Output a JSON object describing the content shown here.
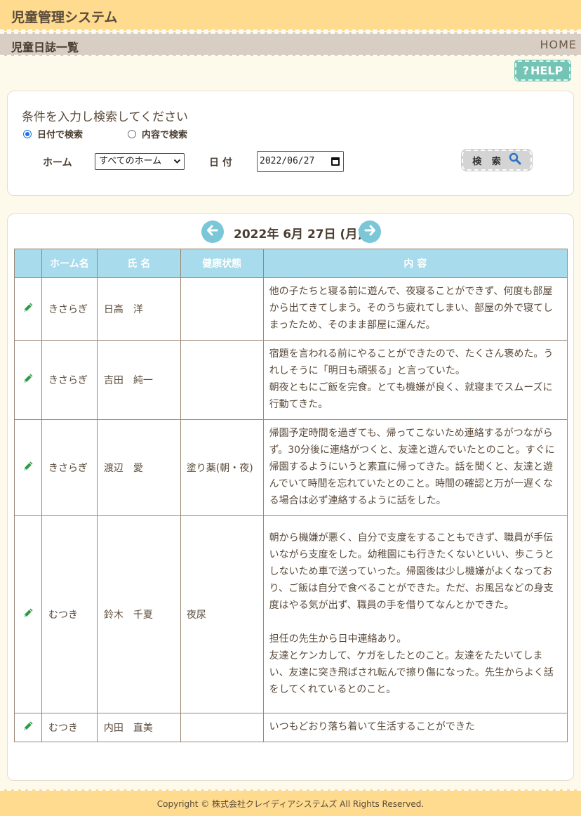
{
  "header": {
    "app_title": "児童管理システム"
  },
  "subheader": {
    "page_title": "児童日誌一覧",
    "home_link": "HOME"
  },
  "help": {
    "label": "HELP",
    "icon_text": "?"
  },
  "search": {
    "prompt": "条件を入力し検索してください",
    "radio_date": "日付で検索",
    "radio_content": "内容で検索",
    "radio_selected": "date",
    "home_label": "ホーム",
    "home_value": "すべてのホーム",
    "date_label": "日 付",
    "date_value": "2022/06/27",
    "button_label": "検 索"
  },
  "results": {
    "date_heading": "2022年 6月 27日 (月)",
    "columns": [
      "ホーム名",
      "氏 名",
      "健康状態",
      "内 容"
    ],
    "rows": [
      {
        "home": "きさらぎ",
        "name": "日高　洋",
        "health": "",
        "content": "他の子たちと寝る前に遊んで、夜寝ることができず、何度も部屋から出てきてしまう。そのうち疲れてしまい、部屋の外で寝てしまったため、そのまま部屋に運んだ。"
      },
      {
        "home": "きさらぎ",
        "name": "吉田　純一",
        "health": "",
        "content": "宿題を言われる前にやることができたので、たくさん褒めた。うれしそうに「明日も頑張る」と言っていた。\n朝夜ともにご飯を完食。とても機嫌が良く、就寝までスムーズに行動てきた。"
      },
      {
        "home": "きさらぎ",
        "name": "渡辺　愛",
        "health": "塗り薬(朝・夜)",
        "content": "帰園予定時間を過ぎても、帰ってこないため連絡するがつながらず。30分後に連絡がつくと、友達と遊んでいたとのこと。すぐに帰園するようにいうと素直に帰ってきた。話を聞くと、友達と遊んでいて時間を忘れていたとのこと。時間の確認と万が一遅くなる場合は必ず連絡するように話をした。"
      },
      {
        "home": "むつき",
        "name": "鈴木　千夏",
        "health": "夜尿",
        "content": "朝から機嫌が悪く、自分で支度をすることもできず、職員が手伝いながら支度をした。幼稚園にも行きたくないといい、歩こうとしないため車で送っていった。帰園後は少し機嫌がよくなっており、ご飯は自分で食べることができた。ただ、お風呂などの身支度はやる気が出ず、職員の手を借りてなんとかできた。\n\n担任の先生から日中連絡あり。\n友達とケンカして、ケガをしたとのこと。友達をたたいてしまい、友達に突き飛ばされ転んで擦り傷になった。先生からよく話をしてくれているとのこと。"
      },
      {
        "home": "むつき",
        "name": "内田　直美",
        "health": "",
        "content": "いつもどおり落ち着いて生活することができた"
      }
    ]
  },
  "footer": {
    "copyright": "Copyright © 株式会社クレイディアシステムズ All Rights Reserved."
  },
  "colors": {
    "header_bg": "#fedb8e",
    "subheader_bg": "#d9cec3",
    "help_bg": "#74c4b6",
    "table_header_bg": "#a8dbeb",
    "nav_arrow": "#7bc7d8",
    "pencil": "#2e9a48"
  },
  "icons": {
    "help": "question-mark-icon",
    "search": "magnifier-icon",
    "prev": "arrow-left-icon",
    "next": "arrow-right-icon",
    "edit": "pencil-icon",
    "date_picker": "calendar-icon"
  }
}
